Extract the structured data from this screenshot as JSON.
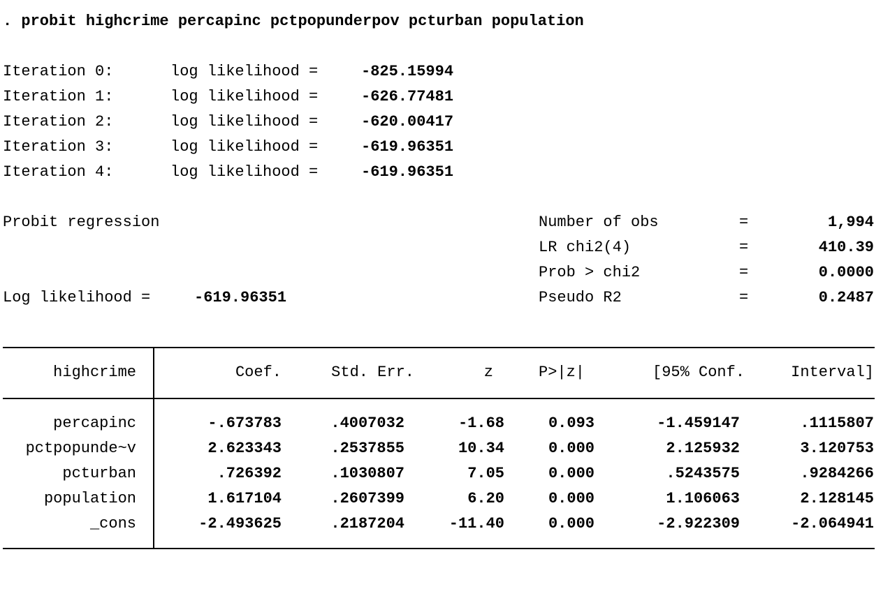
{
  "command": ". probit highcrime percapinc pctpopunderpov pcturban population",
  "iterations": [
    {
      "label": "Iteration 0:",
      "text": "log likelihood =",
      "value": "-825.15994"
    },
    {
      "label": "Iteration 1:",
      "text": "log likelihood =",
      "value": "-626.77481"
    },
    {
      "label": "Iteration 2:",
      "text": "log likelihood =",
      "value": "-620.00417"
    },
    {
      "label": "Iteration 3:",
      "text": "log likelihood =",
      "value": "-619.96351"
    },
    {
      "label": "Iteration 4:",
      "text": "log likelihood =",
      "value": "-619.96351"
    }
  ],
  "model_title": "Probit regression",
  "loglik_label": "Log likelihood =",
  "loglik_value": "-619.96351",
  "stats": [
    {
      "label": "Number of obs",
      "eq": "=",
      "value": "1,994"
    },
    {
      "label": "LR chi2(4)",
      "eq": "=",
      "value": "410.39"
    },
    {
      "label": "Prob > chi2",
      "eq": "=",
      "value": "0.0000"
    },
    {
      "label": "Pseudo R2",
      "eq": "=",
      "value": "0.2487"
    }
  ],
  "table": {
    "depvar": "highcrime",
    "headers": [
      "Coef.",
      "Std. Err.",
      "z",
      "P>|z|",
      "[95% Conf.",
      "Interval]"
    ],
    "rows": [
      {
        "var": "percapinc",
        "cells": [
          "-.673783",
          ".4007032",
          "-1.68",
          "0.093",
          "-1.459147",
          ".1115807"
        ]
      },
      {
        "var": "pctpopunde~v",
        "cells": [
          "2.623343",
          ".2537855",
          "10.34",
          "0.000",
          "2.125932",
          "3.120753"
        ]
      },
      {
        "var": "pcturban",
        "cells": [
          ".726392",
          ".1030807",
          "7.05",
          "0.000",
          ".5243575",
          ".9284266"
        ]
      },
      {
        "var": "population",
        "cells": [
          "1.617104",
          ".2607399",
          "6.20",
          "0.000",
          "1.106063",
          "2.128145"
        ]
      },
      {
        "var": "_cons",
        "cells": [
          "-2.493625",
          ".2187204",
          "-11.40",
          "0.000",
          "-2.922309",
          "-2.064941"
        ]
      }
    ]
  }
}
